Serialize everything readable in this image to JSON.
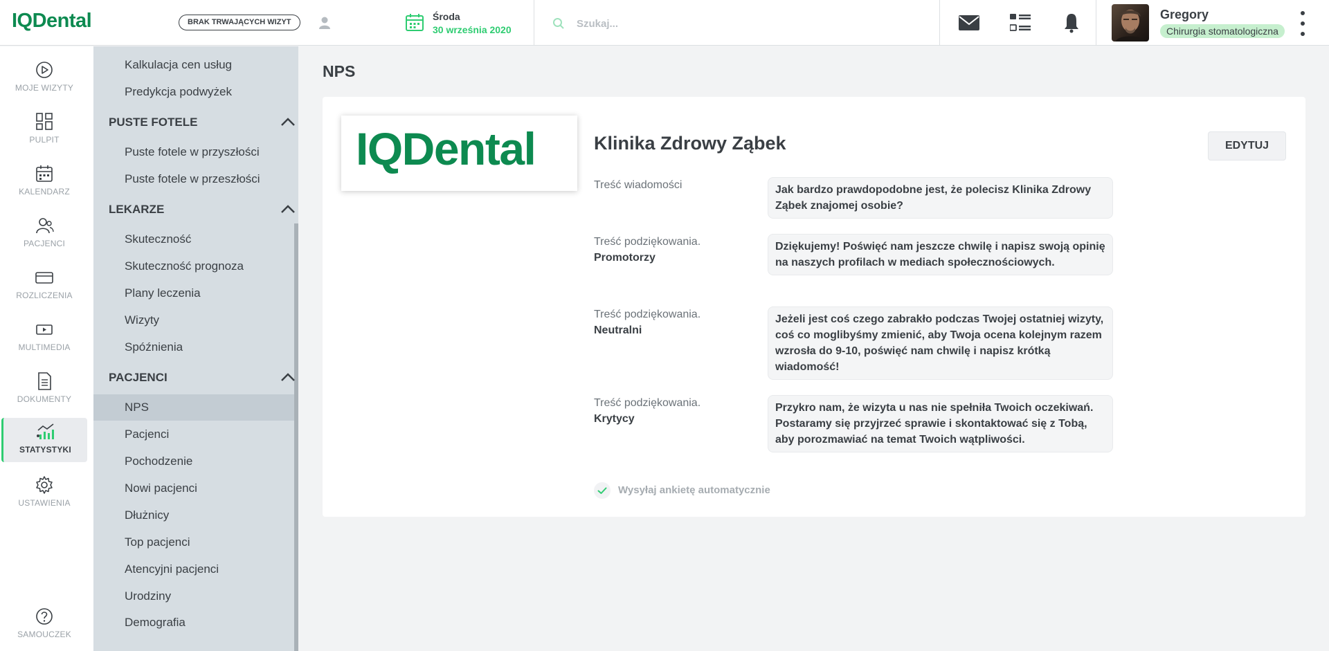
{
  "topbar": {
    "logo": "IQDental",
    "visit_status": "BRAK TRWAJĄCYCH WIZYT",
    "user_icon": "user-icon",
    "calendar_icon": "calendar-icon",
    "day": "Środa",
    "date": "30 września 2020",
    "search_placeholder": "Szukaj...",
    "search_icon": "search-icon",
    "icons": [
      "mail-icon",
      "list-icon",
      "bell-icon"
    ],
    "user_name": "Gregory",
    "user_role": "Chirurgia stomatologiczna",
    "menu_icon": "kebab-menu-icon"
  },
  "leftnav": {
    "items": [
      {
        "label": "MOJE WIZYTY",
        "icon": "play-circle-icon"
      },
      {
        "label": "PULPIT",
        "icon": "dashboard-icon"
      },
      {
        "label": "KALENDARZ",
        "icon": "calendar-icon"
      },
      {
        "label": "PACJENCI",
        "icon": "patients-icon"
      },
      {
        "label": "ROZLICZENIA",
        "icon": "card-icon"
      },
      {
        "label": "MULTIMEDIA",
        "icon": "media-icon"
      },
      {
        "label": "DOKUMENTY",
        "icon": "document-icon"
      },
      {
        "label": "STATYSTYKI",
        "icon": "stats-icon",
        "active": true
      },
      {
        "label": "USTAWIENIA",
        "icon": "gear-icon"
      }
    ],
    "help": {
      "label": "SAMOUCZEK",
      "icon": "help-icon"
    }
  },
  "submenu": {
    "top_items": [
      "Kalkulacja cen usług",
      "Predykcja podwyżek"
    ],
    "sections": [
      {
        "title": "PUSTE FOTELE",
        "items": [
          "Puste fotele w przyszłości",
          "Puste fotele w przeszłości"
        ]
      },
      {
        "title": "LEKARZE",
        "items": [
          "Skuteczność",
          "Skuteczność prognoza",
          "Plany leczenia",
          "Wizyty",
          "Spóźnienia"
        ]
      },
      {
        "title": "PACJENCI",
        "items": [
          "NPS",
          "Pacjenci",
          "Pochodzenie",
          "Nowi pacjenci",
          "Dłużnicy",
          "Top pacjenci",
          "Atencyjni pacjenci",
          "Urodziny",
          "Demografia"
        ]
      }
    ],
    "active_item": "NPS"
  },
  "main": {
    "page_title": "NPS",
    "logo_text": "IQDental",
    "clinic_name": "Klinika Zdrowy Ząbek",
    "edit_label": "EDYTUJ",
    "rows": [
      {
        "label": "Treść wiadomości",
        "sub": "",
        "text": "Jak bardzo prawdopodobne jest, że polecisz Klinika Zdrowy Ząbek znajomej osobie?"
      },
      {
        "label": "Treść podziękowania.",
        "sub": "Promotorzy",
        "text": "Dziękujemy! Poświęć nam jeszcze chwilę i napisz swoją opinię na naszych profilach w mediach społecznościowych."
      },
      {
        "label": "Treść podziękowania.",
        "sub": "Neutralni",
        "text": "Jeżeli jest coś czego zabrakło podczas Twojej ostatniej wizyty, coś co moglibyśmy zmienić, aby Twoja ocena kolejnym razem wzrosła do 9-10, poświęć nam chwilę i napisz krótką wiadomość!"
      },
      {
        "label": "Treść podziękowania.",
        "sub": "Krytycy",
        "text": "Przykro nam, że wizyta u nas nie spełniła Twoich oczekiwań. Postaramy się przyjrzeć sprawie i skontaktować się z Tobą, aby porozmawiać na temat Twoich wątpliwości."
      }
    ],
    "auto_send_label": "Wysyłaj ankietę automatycznie",
    "auto_send_checked": true
  },
  "colors": {
    "brand": "#0d8a50",
    "accent": "#2ecc71",
    "submenu_bg": "#d6dde2",
    "role_badge": "#c6efce"
  }
}
